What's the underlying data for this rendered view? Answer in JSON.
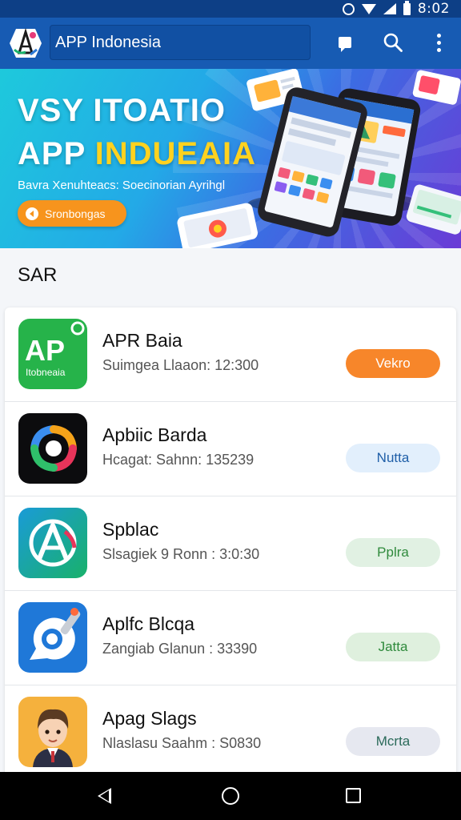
{
  "status_bar": {
    "time": "8:02",
    "icons": [
      "alarm-icon",
      "wifi-icon",
      "signal-icon",
      "battery-icon"
    ]
  },
  "app_bar": {
    "title": "APP Indonesia",
    "icons": [
      "app-logo",
      "chat-icon",
      "search-icon",
      "more-vert-icon"
    ]
  },
  "banner": {
    "line1": "VSY ITOATIO",
    "line2_white": "APP",
    "line2_yellow": "INDUEAIA",
    "subtitle": "Bavra Xenuhteacs: Soecinorian Ayrihgl",
    "cta_label": "Sronbongas",
    "colors": {
      "gradient_start": "#1ec9dc",
      "gradient_end": "#6a3bd6",
      "highlight": "#ffd21f",
      "cta": "#f7941d"
    }
  },
  "section": {
    "title": "SAR"
  },
  "apps": [
    {
      "name": "APR Baia",
      "meta": "Suimgea Llaaon: 12:300",
      "button": "Vekro",
      "icon": "ap-indonesia-icon",
      "icon_text": "AP",
      "icon_subtext": "Itobneaia",
      "button_bg": "#f7862a",
      "button_fg": "#ffffff"
    },
    {
      "name": "Apbiic Barda",
      "meta": "Hcagat: Sahnn: 135239",
      "button": "Nutta",
      "icon": "colorful-camera-icon",
      "button_bg": "#e2effc",
      "button_fg": "#1f5fa8"
    },
    {
      "name": "Spblac",
      "meta": "Slsagiek 9 Ronn : 3:0:30",
      "button": "Pplra",
      "icon": "letter-a-icon",
      "button_bg": "#e1f1e3",
      "button_fg": "#2f8a3c"
    },
    {
      "name": "Aplfc Blcqa",
      "meta": "Zangiab Glanun : 33390",
      "button": "Jatta",
      "icon": "chat-bubble-icon",
      "button_bg": "#dff0de",
      "button_fg": "#2f8a3c"
    },
    {
      "name": "Apag Slags",
      "meta": "Nlaslasu Saahm : S0830",
      "button": "Mcrta",
      "icon": "cartoon-avatar-icon",
      "button_bg": "#e6e8f0",
      "button_fg": "#2b6a5a"
    }
  ],
  "nav_bar": {
    "icons": [
      "back-icon",
      "home-icon",
      "recents-icon"
    ]
  }
}
